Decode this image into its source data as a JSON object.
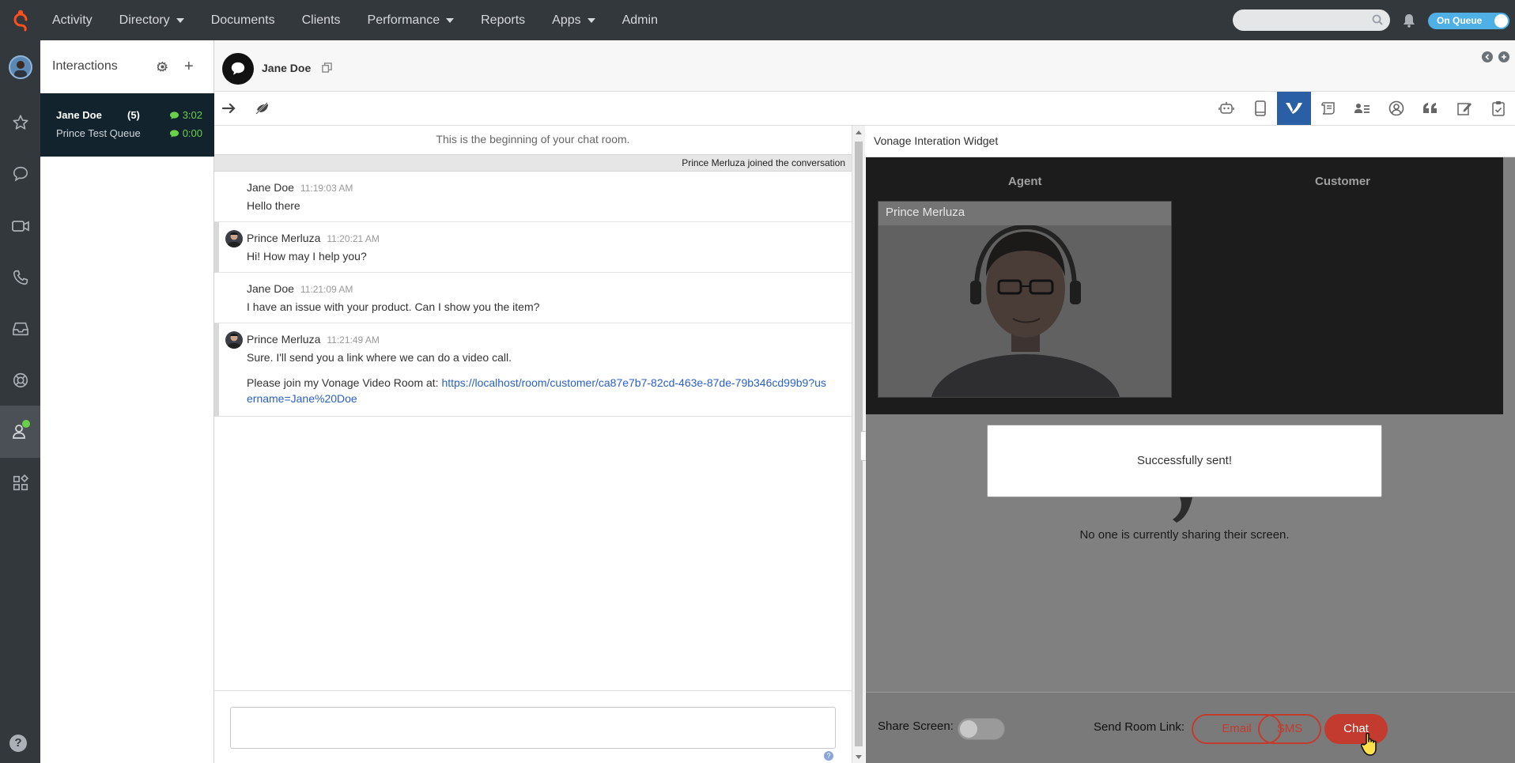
{
  "nav": {
    "items": [
      {
        "label": "Activity",
        "caret": false
      },
      {
        "label": "Directory",
        "caret": true
      },
      {
        "label": "Documents",
        "caret": false
      },
      {
        "label": "Clients",
        "caret": false
      },
      {
        "label": "Performance",
        "caret": true
      },
      {
        "label": "Reports",
        "caret": false
      },
      {
        "label": "Apps",
        "caret": true
      },
      {
        "label": "Admin",
        "caret": false
      }
    ],
    "search_placeholder": "",
    "status_label": "On Queue"
  },
  "interactions": {
    "title": "Interactions",
    "card": {
      "name": "Jane Doe",
      "count": "(5)",
      "queue": "Prince Test Queue",
      "time1": "3:02",
      "time2": "0:00"
    }
  },
  "conversation": {
    "name": "Jane Doe",
    "chat_begin": "This is the beginning of your chat room.",
    "joined": "Prince Merluza joined the conversation",
    "messages": [
      {
        "who": "Jane Doe",
        "time": "11:19:03 AM",
        "text": "Hello there",
        "agent": false
      },
      {
        "who": "Prince Merluza",
        "time": "11:20:21 AM",
        "text": "Hi! How may I help you?",
        "agent": true
      },
      {
        "who": "Jane Doe",
        "time": "11:21:09 AM",
        "text": "I have an issue with your product. Can I show you the item?",
        "agent": false
      },
      {
        "who": "Prince Merluza",
        "time": "11:21:49 AM",
        "text": "Sure. I'll send you a link where we can do a video call.",
        "agent": true,
        "text2_prefix": "Please join my Vonage Video Room at: ",
        "link": "https://localhost/room/customer/ca87e7b7-82cd-463e-87de-79b346cd99b9?username=Jane%20Doe"
      }
    ]
  },
  "widget": {
    "title": "Vonage Interation Widget",
    "agent_label": "Agent",
    "customer_label": "Customer",
    "agent_name": "Prince Merluza",
    "toast": "Successfully sent!",
    "share_note": "No one is currently sharing their screen.",
    "share_screen_label": "Share Screen:",
    "send_room_link_label": "Send Room Link:",
    "buttons": {
      "email": "Email",
      "sms": "SMS",
      "chat": "Chat"
    }
  },
  "colors": {
    "topbar": "#33383d",
    "accent_orange": "#ff4f1f",
    "queue_blue": "#4fb0e6",
    "active_tab": "#2a5ea5",
    "timer_green": "#6ad04a",
    "button_red": "#c33b2e"
  },
  "icons": {
    "rail": [
      "avatar",
      "star-icon",
      "chat-icon",
      "video-icon",
      "phone-icon",
      "inbox-icon",
      "lifebuoy-icon",
      "agent-status-icon",
      "apps-icon",
      "help-icon"
    ],
    "toolbar_right": [
      "bot-icon",
      "tablet-icon",
      "vonage-icon",
      "script-icon",
      "contact-card-icon",
      "user-circle-icon",
      "quote-icon",
      "edit-icon",
      "clipboard-icon"
    ]
  }
}
